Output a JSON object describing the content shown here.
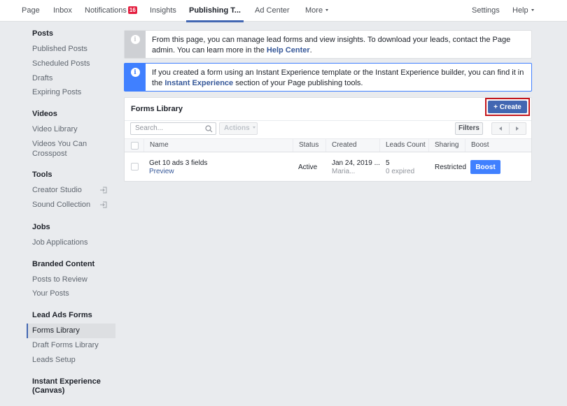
{
  "topnav": {
    "items": [
      {
        "label": "Page"
      },
      {
        "label": "Inbox"
      },
      {
        "label": "Notifications",
        "badge": "16"
      },
      {
        "label": "Insights"
      },
      {
        "label": "Publishing T...",
        "active": true
      },
      {
        "label": "Ad Center"
      },
      {
        "label": "More"
      }
    ],
    "settings": "Settings",
    "help": "Help"
  },
  "sidebar": {
    "sections": [
      {
        "title": "Posts",
        "items": [
          "Published Posts",
          "Scheduled Posts",
          "Drafts",
          "Expiring Posts"
        ]
      },
      {
        "title": "Videos",
        "items": [
          "Video Library",
          "Videos You Can Crosspost"
        ]
      },
      {
        "title": "Tools",
        "items": [
          "Creator Studio",
          "Sound Collection"
        ]
      },
      {
        "title": "Jobs",
        "items": [
          "Job Applications"
        ]
      },
      {
        "title": "Branded Content",
        "items": [
          "Posts to Review",
          "Your Posts"
        ]
      },
      {
        "title": "Lead Ads Forms",
        "items": [
          "Forms Library",
          "Draft Forms Library",
          "Leads Setup"
        ],
        "selected": "Forms Library"
      },
      {
        "title": "Instant Experience (Canvas)",
        "items": []
      }
    ]
  },
  "info": {
    "box1_text": "From this page, you can manage lead forms and view insights. To download your leads, contact the Page admin. You can learn more in the ",
    "box1_link": "Help Center",
    "box1_end": ".",
    "box2_text": "If you created a form using an Instant Experience template or the Instant Experience builder, you can find it in the ",
    "box2_link": "Instant Experience",
    "box2_end": " section of your Page publishing tools."
  },
  "forms_library": {
    "title": "Forms Library",
    "create_label": "+ Create",
    "search_placeholder": "Search...",
    "actions_label": "Actions",
    "filters_label": "Filters",
    "columns": [
      "Name",
      "Status",
      "Created",
      "Leads Count",
      "Sharing",
      "Boost"
    ],
    "rows": [
      {
        "name": "Get 10 ads 3 fields",
        "preview": "Preview",
        "status": "Active",
        "created": "Jan 24, 2019 ...",
        "created_by": "Maria...",
        "leads": "5",
        "expired": "0 expired",
        "sharing": "Restricted",
        "boost": "Boost"
      }
    ]
  },
  "colors": {
    "brand_blue": "#4267b2",
    "accent_blue": "#4080ff",
    "highlight_red": "#c4161c",
    "badge_red": "#e41e3f"
  }
}
